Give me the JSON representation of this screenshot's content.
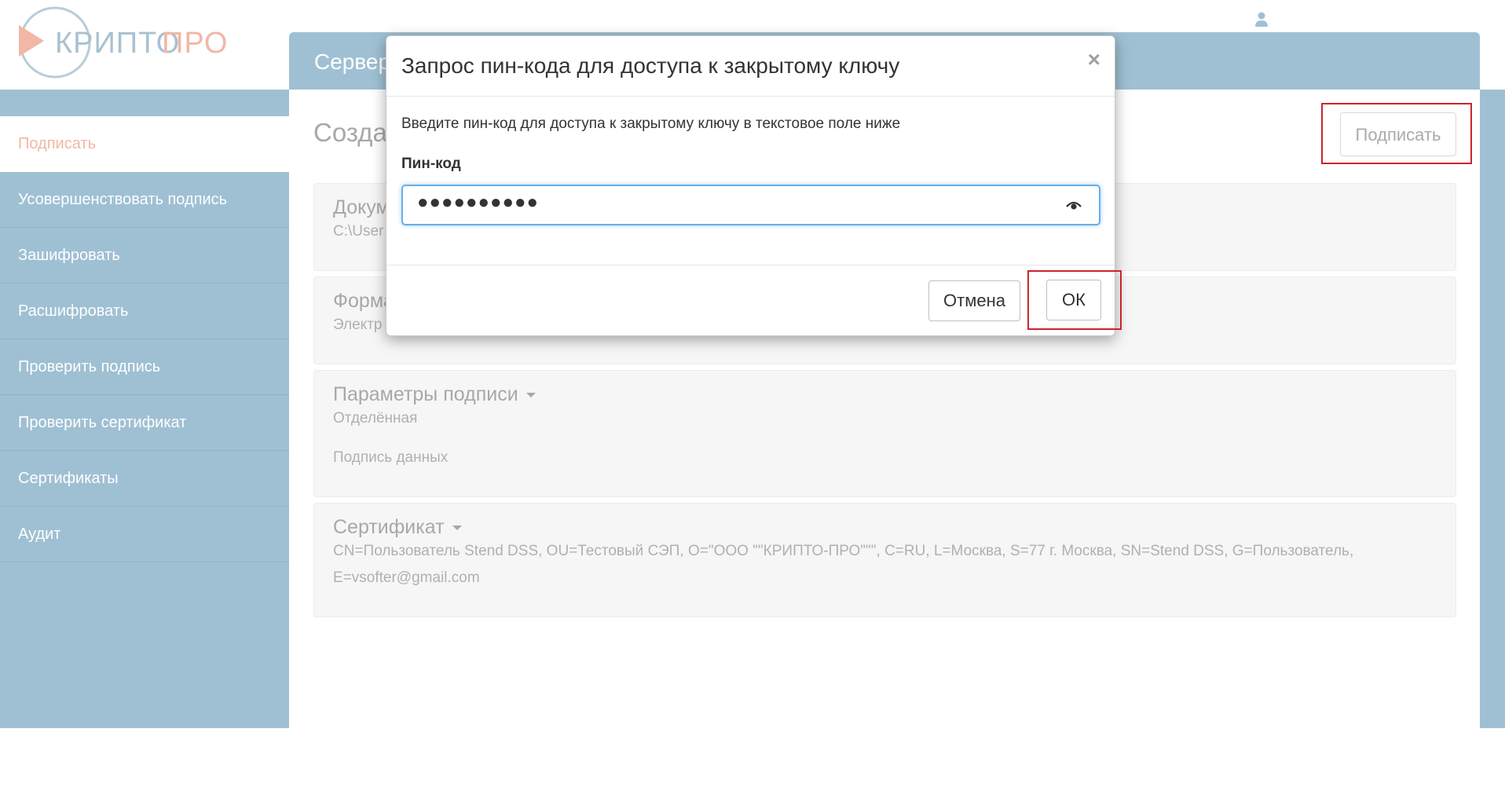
{
  "logo": {
    "text_left": "КРИПТО",
    "text_right": "ПРО"
  },
  "header": {
    "title": "Сервер"
  },
  "sidebar": {
    "items": [
      {
        "label": "Подписать"
      },
      {
        "label": "Усовершенствовать подпись"
      },
      {
        "label": "Зашифровать"
      },
      {
        "label": "Расшифровать"
      },
      {
        "label": "Проверить подпись"
      },
      {
        "label": "Проверить сертификат"
      },
      {
        "label": "Сертификаты"
      },
      {
        "label": "Аудит"
      }
    ]
  },
  "main": {
    "title": "Созда",
    "sign_button": "Подписать",
    "document": {
      "title": "Докум",
      "value": "C:\\User"
    },
    "format": {
      "title": "Форма",
      "value": "Электр"
    },
    "signature_params": {
      "title": "Параметры подписи",
      "type": "Отделённая",
      "mode": "Подпись данных"
    },
    "certificate": {
      "title": "Сертификат",
      "line1": "CN=Пользователь Stend DSS, OU=Тестовый СЭП, O=\"ООО \"\"КРИПТО-ПРО\"\"\", C=RU, L=Москва, S=77 г. Москва, SN=Stend DSS, G=Пользователь,",
      "line2": "E=vsofter@gmail.com"
    }
  },
  "modal": {
    "title": "Запрос пин-кода для доступа к закрытому ключу",
    "close": "×",
    "description": "Введите пин-код для доступа к закрытому ключу в текстовое поле ниже",
    "pin_label": "Пин-код",
    "pin_value": "●●●●●●●●●●",
    "cancel": "Отмена",
    "ok": "ОК"
  },
  "colors": {
    "sidebar_bg": "#9fc0d3",
    "active_text": "#f2b7a5",
    "highlight_border": "#c9252f",
    "input_focus": "#66afe9"
  }
}
